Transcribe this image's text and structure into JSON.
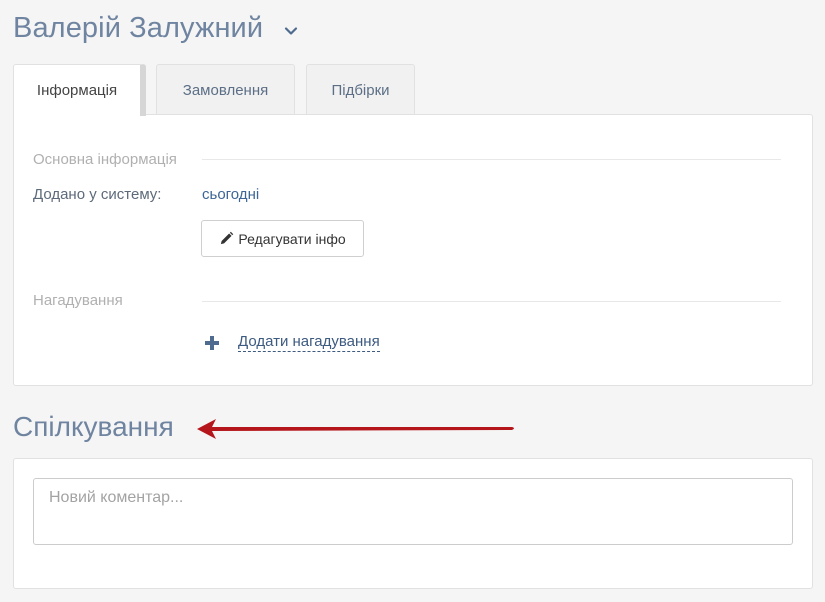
{
  "header": {
    "title": "Валерій Залужний",
    "dropdown_icon": "chevron-down-icon"
  },
  "tabs": [
    {
      "label": "Інформація",
      "active": true
    },
    {
      "label": "Замовлення",
      "active": false
    },
    {
      "label": "Підбірки",
      "active": false
    }
  ],
  "info": {
    "section_basic": "Основна інформація",
    "added_label": "Додано у систему:",
    "added_value": "сьогодні",
    "edit_button": "Редагувати інфо",
    "section_reminders": "Нагадування",
    "add_reminder": "Додати нагадування"
  },
  "communication": {
    "title": "Спілкування",
    "comment_placeholder": "Новий коментар..."
  },
  "colors": {
    "accent_title": "#6f84a0",
    "link": "#3d6596",
    "arrow": "#b5161b"
  }
}
